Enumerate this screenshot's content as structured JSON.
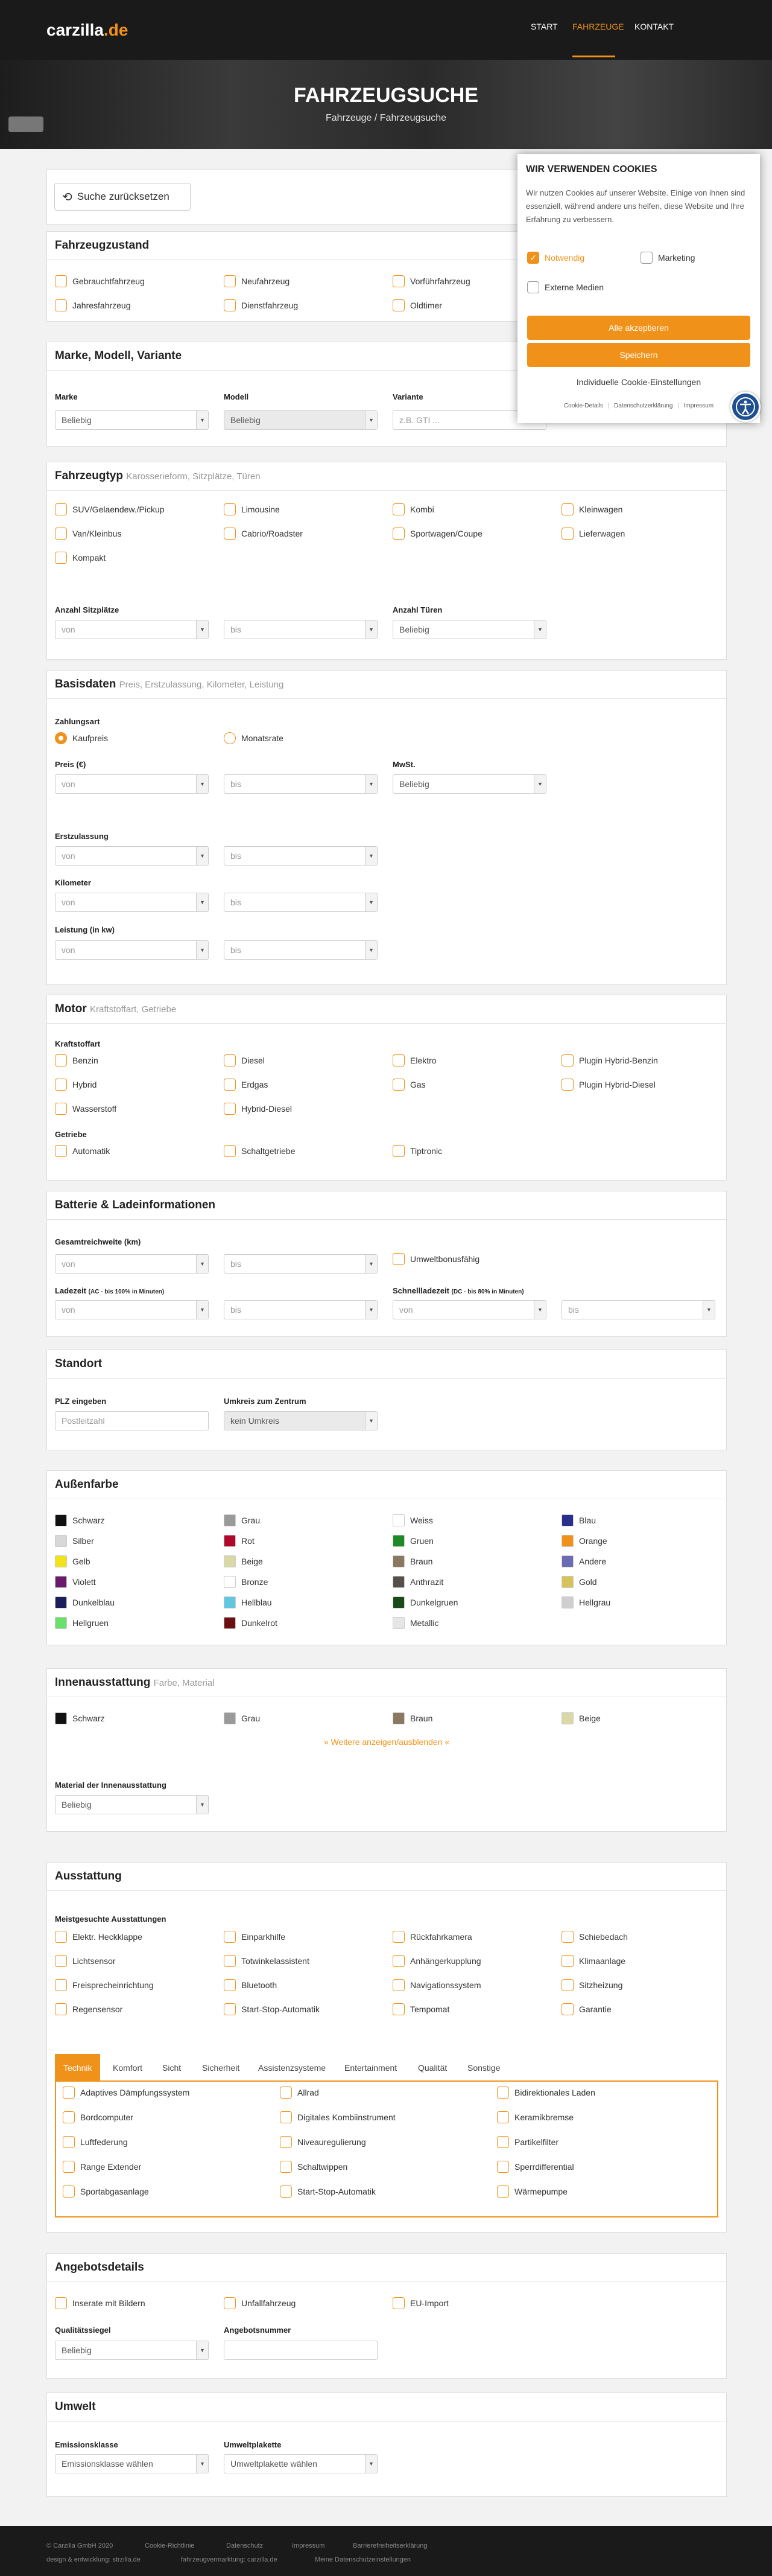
{
  "logo": {
    "text": "carzilla",
    "tld": ".de"
  },
  "nav": [
    "START",
    "FAHRZEUGE",
    "KONTAKT"
  ],
  "hero": {
    "title": "FAHRZEUGSUCHE",
    "breadcrumb": "Fahrzeuge / Fahrzeugsuche"
  },
  "reset": "Suche zurücksetzen",
  "zustand": {
    "title": "Fahrzeugzustand",
    "items": [
      "Gebrauchtfahrzeug",
      "Neufahrzeug",
      "Vorführfahrzeug",
      "Jahresfahrzeug",
      "Dienstfahrzeug",
      "Oldtimer"
    ]
  },
  "marke": {
    "title": "Marke, Modell, Variante",
    "lmarke": "Marke",
    "lmodell": "Modell",
    "lvariante": "Variante",
    "vmarke": "Beliebig",
    "vmodell": "Beliebig",
    "pvariante": "z.B. GTI ..."
  },
  "typ": {
    "title": "Fahrzeugtyp",
    "sub": "Karosserieform, Sitzplätze, Türen",
    "items": [
      "SUV/Gelaendew./Pickup",
      "Limousine",
      "Kombi",
      "Kleinwagen",
      "Van/Kleinbus",
      "Cabrio/Roadster",
      "Sportwagen/Coupe",
      "Lieferwagen",
      "Kompakt"
    ],
    "lsitz": "Anzahl Sitzplätze",
    "ltueren": "Anzahl Türen",
    "von": "von",
    "bis": "bis",
    "beliebig": "Beliebig"
  },
  "basis": {
    "title": "Basisdaten",
    "sub": "Preis, Erstzulassung, Kilometer, Leistung",
    "lzahl": "Zahlungsart",
    "kauf": "Kaufpreis",
    "monat": "Monatsrate",
    "lpreis": "Preis (€)",
    "lmwst": "MwSt.",
    "lerst": "Erstzulassung",
    "lkm": "Kilometer",
    "lleist": "Leistung (in kw)"
  },
  "motor": {
    "title": "Motor",
    "sub": "Kraftstoffart, Getriebe",
    "lkraft": "Kraftstoffart",
    "fuels": [
      "Benzin",
      "Diesel",
      "Elektro",
      "Plugin Hybrid-Benzin",
      "Hybrid",
      "Erdgas",
      "Gas",
      "Plugin Hybrid-Diesel",
      "Wasserstoff",
      "Hybrid-Diesel"
    ],
    "lgetr": "Getriebe",
    "gears": [
      "Automatik",
      "Schaltgetriebe",
      "Tiptronic"
    ]
  },
  "batt": {
    "title": "Batterie & Ladeinformationen",
    "lgr": "Gesamtreichweite (km)",
    "bonus": "Umweltbonusfähig",
    "lladeA": "Ladezeit",
    "lladeB": "(AC - bis 100% in Minuten)",
    "lschnellA": "Schnellladezeit",
    "lschnellB": "(DC - bis 80% in Minuten)"
  },
  "standort": {
    "title": "Standort",
    "lplz": "PLZ eingeben",
    "pplz": "Postleitzahl",
    "lumkreis": "Umkreis zum Zentrum",
    "vumkreis": "kein Umkreis"
  },
  "aussen": {
    "title": "Außenfarbe",
    "colors": [
      {
        "n": "Schwarz",
        "c": "#111111"
      },
      {
        "n": "Grau",
        "c": "#9a9a9a"
      },
      {
        "n": "Weiss",
        "c": "#ffffff"
      },
      {
        "n": "Blau",
        "c": "#2b2f8c"
      },
      {
        "n": "Silber",
        "c": "#d8d8d8"
      },
      {
        "n": "Rot",
        "c": "#b0082b"
      },
      {
        "n": "Gruen",
        "c": "#1e8a24"
      },
      {
        "n": "Orange",
        "c": "#f0921a"
      },
      {
        "n": "Gelb",
        "c": "#f2e21a"
      },
      {
        "n": "Beige",
        "c": "#d9d8a6"
      },
      {
        "n": "Braun",
        "c": "#8a7860"
      },
      {
        "n": "Andere",
        "c": "#6a6ab5"
      },
      {
        "n": "Violett",
        "c": "#6a1a6a"
      },
      {
        "n": "Bronze",
        "c": "#ffffff"
      },
      {
        "n": "Anthrazit",
        "c": "#55504a"
      },
      {
        "n": "Gold",
        "c": "#d8c25a"
      },
      {
        "n": "Dunkelblau",
        "c": "#1a1e5a"
      },
      {
        "n": "Hellblau",
        "c": "#5fc8dc"
      },
      {
        "n": "Dunkelgruen",
        "c": "#1a4a1a"
      },
      {
        "n": "Hellgrau",
        "c": "#cfcfcf"
      },
      {
        "n": "Hellgruen",
        "c": "#6bdf6b"
      },
      {
        "n": "Dunkelrot",
        "c": "#6a1010"
      },
      {
        "n": "Metallic",
        "c": "#e6e6e6"
      }
    ]
  },
  "innen": {
    "title": "Innenausstattung",
    "sub": "Farbe, Material",
    "colors": [
      {
        "n": "Schwarz",
        "c": "#111111"
      },
      {
        "n": "Grau",
        "c": "#9a9a9a"
      },
      {
        "n": "Braun",
        "c": "#8a7860"
      },
      {
        "n": "Beige",
        "c": "#d9d8a6"
      }
    ],
    "more": "» Weitere anzeigen/ausblenden «",
    "lmat": "Material der Innenausstattung",
    "vmat": "Beliebig"
  },
  "ausst": {
    "title": "Ausstattung",
    "lmeist": "Meistgesuchte Ausstattungen",
    "items": [
      "Elektr. Heckklappe",
      "Einparkhilfe",
      "Rückfahrkamera",
      "Schiebedach",
      "Lichtsensor",
      "Totwinkelassistent",
      "Anhängerkupplung",
      "Klimaanlage",
      "Freisprecheinrichtung",
      "Bluetooth",
      "Navigationssystem",
      "Sitzheizung",
      "Regensensor",
      "Start-Stop-Automatik",
      "Tempomat",
      "Garantie"
    ],
    "tabs": [
      "Technik",
      "Komfort",
      "Sicht",
      "Sicherheit",
      "Assistenzsysteme",
      "Entertainment",
      "Qualität",
      "Sonstige"
    ],
    "tech": [
      "Adaptives Dämpfungssystem",
      "Allrad",
      "Bidirektionales Laden",
      "Bordcomputer",
      "Digitales Kombiinstrument",
      "Keramikbremse",
      "Luftfederung",
      "Niveauregulierung",
      "Partikelfilter",
      "Range Extender",
      "Schaltwippen",
      "Sperrdifferential",
      "Sportabgasanlage",
      "Start-Stop-Automatik",
      "Wärmepumpe"
    ]
  },
  "angebot": {
    "title": "Angebotsdetails",
    "items": [
      "Inserate mit Bildern",
      "Unfallfahrzeug",
      "EU-Import"
    ],
    "lqual": "Qualitätssiegel",
    "vqual": "Beliebig",
    "lnum": "Angebotsnummer"
  },
  "umwelt": {
    "title": "Umwelt",
    "lklasse": "Emissionsklasse",
    "vklasse": "Emissionsklasse wählen",
    "lplak": "Umweltplakette",
    "vplak": "Umweltplakette wählen"
  },
  "footer": {
    "row1": [
      "© Carzilla GmbH 2020",
      "Cookie-Richtlinie",
      "Datenschutz",
      "Impressum",
      "Barrierefreiheitserklärung"
    ],
    "row2": [
      "design & entwicklung: strzilla.de",
      "fahrzeugvermarktung: carzilla.de",
      "Meine Datenschutzeinstellungen"
    ]
  },
  "cookie": {
    "title": "WIR VERWENDEN COOKIES",
    "text": "Wir nutzen Cookies auf unserer Website. Einige von ihnen sind essenziell, während andere uns helfen, diese Website und Ihre Erfahrung zu verbessern.",
    "necessary": "Notwendig",
    "marketing": "Marketing",
    "external": "Externe Medien",
    "accept": "Alle akzeptieren",
    "save": "Speichern",
    "individual": "Individuelle Cookie-Einstellungen",
    "links": [
      "Cookie-Details",
      "Datenschutzerklärung",
      "Impressum"
    ]
  }
}
